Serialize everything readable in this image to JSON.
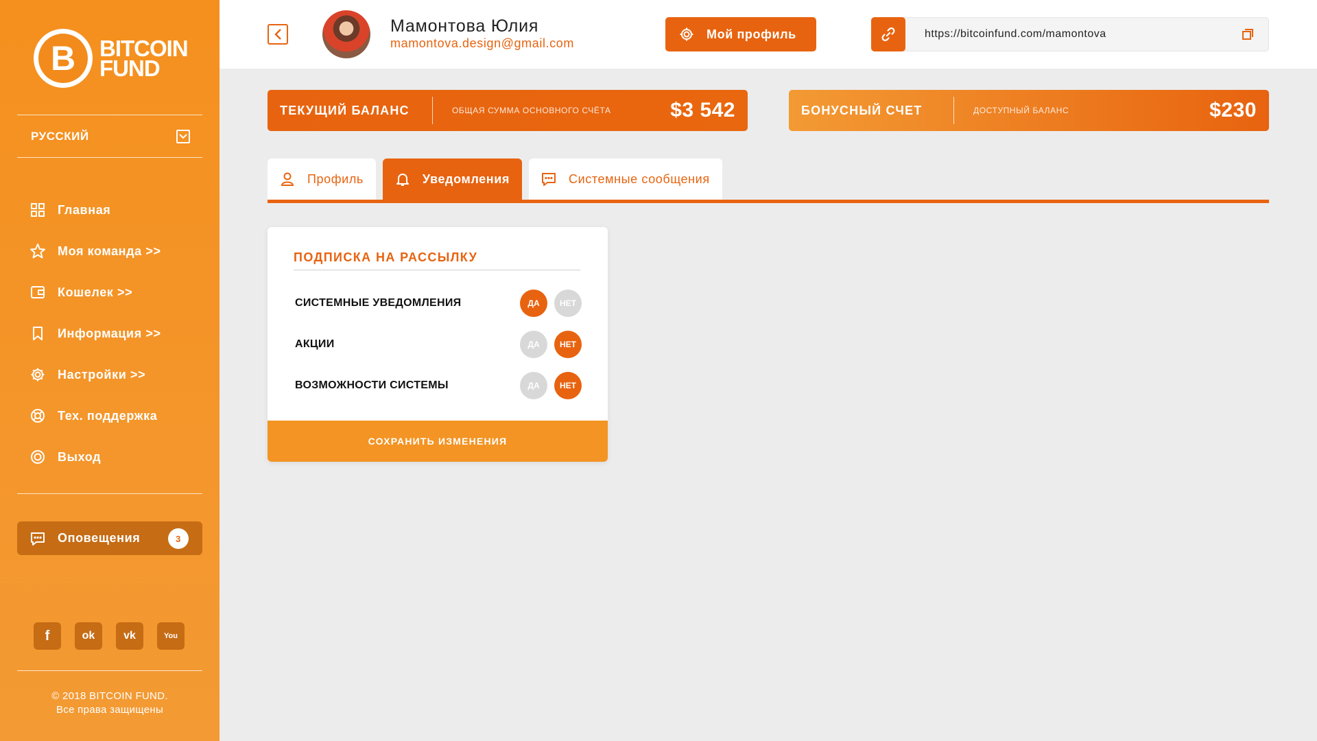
{
  "brand": {
    "line1": "BITCOIN",
    "line2": "FUND",
    "glyph": "B"
  },
  "language": {
    "selected": "РУССКИЙ"
  },
  "sidebar": {
    "items": [
      {
        "label": "Главная",
        "icon": "grid-icon"
      },
      {
        "label": "Моя команда >>",
        "icon": "star-icon"
      },
      {
        "label": "Кошелек >>",
        "icon": "wallet-icon"
      },
      {
        "label": "Информация >>",
        "icon": "bookmark-icon"
      },
      {
        "label": "Настройки >>",
        "icon": "gear-icon"
      },
      {
        "label": "Тех. поддержка",
        "icon": "lifebuoy-icon"
      },
      {
        "label": "Выход",
        "icon": "power-icon"
      }
    ],
    "alerts": {
      "label": "Оповещения",
      "count": "3"
    }
  },
  "social": [
    {
      "name": "facebook",
      "glyph": "f"
    },
    {
      "name": "odnoklassniki",
      "glyph": "ok"
    },
    {
      "name": "vk",
      "glyph": "vk"
    },
    {
      "name": "youtube",
      "glyph": "You"
    }
  ],
  "footer": {
    "copyright": "© 2018 BITCOIN FUND.",
    "rights": "Все права защищены"
  },
  "header": {
    "user_name": "Мамонтова Юлия",
    "user_email": "mamontova.design@gmail.com",
    "profile_button": "Мой профиль",
    "ref_link": "https://bitcoinfund.com/mamontova"
  },
  "balances": {
    "current": {
      "title": "ТЕКУЩИЙ БАЛАНС",
      "subtitle": "ОБЩАЯ СУММА ОСНОВНОГО СЧЁТА",
      "amount": "$3 542"
    },
    "bonus": {
      "title": "БОНУСНЫЙ СЧЕТ",
      "subtitle": "ДОСТУПНЫЙ БАЛАНС",
      "amount": "$230"
    }
  },
  "tabs": [
    {
      "label": "Профиль",
      "icon": "user-icon",
      "active": false
    },
    {
      "label": "Уведомления",
      "icon": "bell-icon",
      "active": true
    },
    {
      "label": "Системные сообщения",
      "icon": "chat-icon",
      "active": false
    }
  ],
  "subscription": {
    "title": "ПОДПИСКА НА РАССЫЛКУ",
    "yes_label": "ДА",
    "no_label": "НЕТ",
    "options": [
      {
        "label": "СИСТЕМНЫЕ УВЕДОМЛЕНИЯ",
        "value": "yes"
      },
      {
        "label": "АКЦИИ",
        "value": "no"
      },
      {
        "label": "ВОЗМОЖНОСТИ СИСТЕМЫ",
        "value": "no"
      }
    ],
    "save_label": "СОХРАНИТЬ ИЗМЕНЕНИЯ"
  },
  "colors": {
    "accent": "#e8630f",
    "sidebar": "#f5901e",
    "inactive_pill": "#d8d8d8"
  }
}
